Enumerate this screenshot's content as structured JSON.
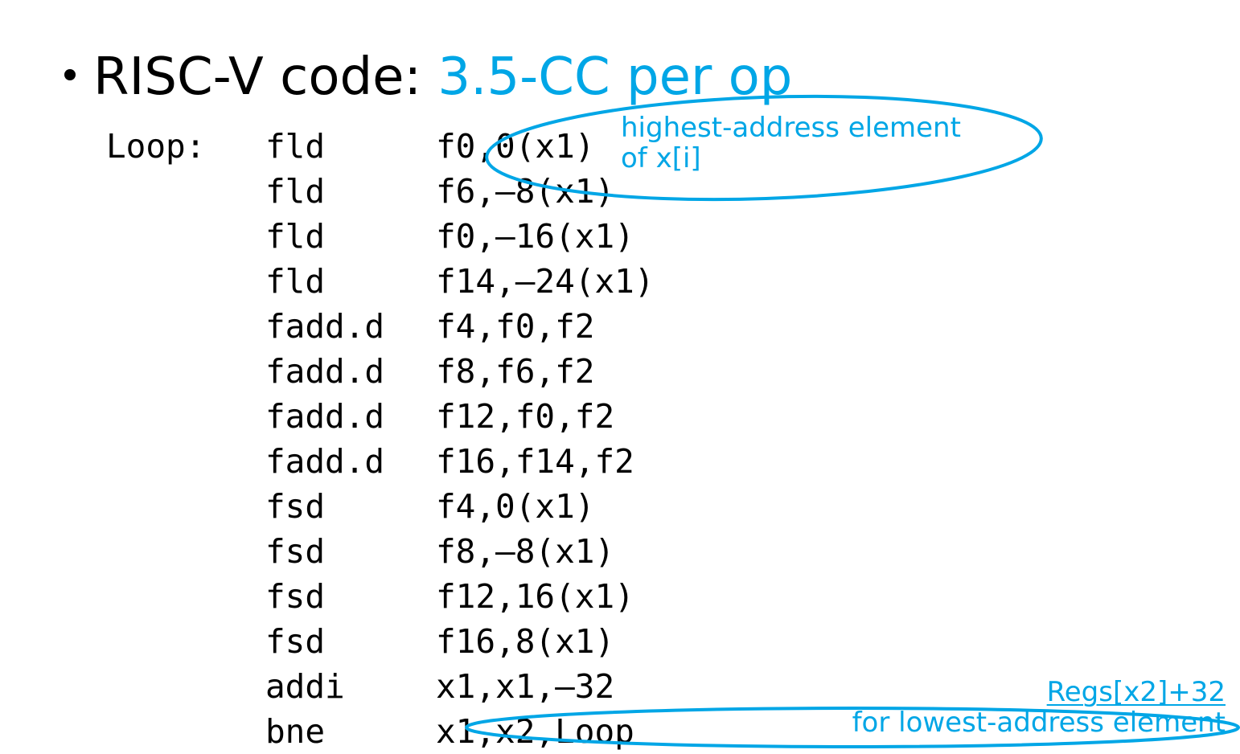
{
  "slide": {
    "title_prefix": "RISC-V code: ",
    "title_accent": "3.5-CC per op",
    "accent_color": "#00a6e6",
    "code": [
      {
        "label": "Loop:",
        "op": "fld",
        "args": "f0,0(x1)"
      },
      {
        "label": "",
        "op": "fld",
        "args": "f6,–8(x1)"
      },
      {
        "label": "",
        "op": "fld",
        "args": "f0,–16(x1)"
      },
      {
        "label": "",
        "op": "fld",
        "args": "f14,–24(x1)"
      },
      {
        "label": "",
        "op": "fadd.d",
        "args": "f4,f0,f2"
      },
      {
        "label": "",
        "op": "fadd.d",
        "args": "f8,f6,f2"
      },
      {
        "label": "",
        "op": "fadd.d",
        "args": "f12,f0,f2"
      },
      {
        "label": "",
        "op": "fadd.d",
        "args": "f16,f14,f2"
      },
      {
        "label": "",
        "op": "fsd",
        "args": "f4,0(x1)"
      },
      {
        "label": "",
        "op": "fsd",
        "args": "f8,–8(x1)"
      },
      {
        "label": "",
        "op": "fsd",
        "args": "f12,16(x1)"
      },
      {
        "label": "",
        "op": "fsd",
        "args": "f16,8(x1)"
      },
      {
        "label": "",
        "op": "addi",
        "args": "x1,x1,–32"
      },
      {
        "label": "",
        "op": "bne",
        "args": "x1,x2,Loop"
      }
    ],
    "annotations": {
      "top_line1": "highest-address element",
      "top_line2": "of x[i]",
      "bottom_line1": "Regs[x2]+32",
      "bottom_line2": "for lowest-address element"
    }
  }
}
